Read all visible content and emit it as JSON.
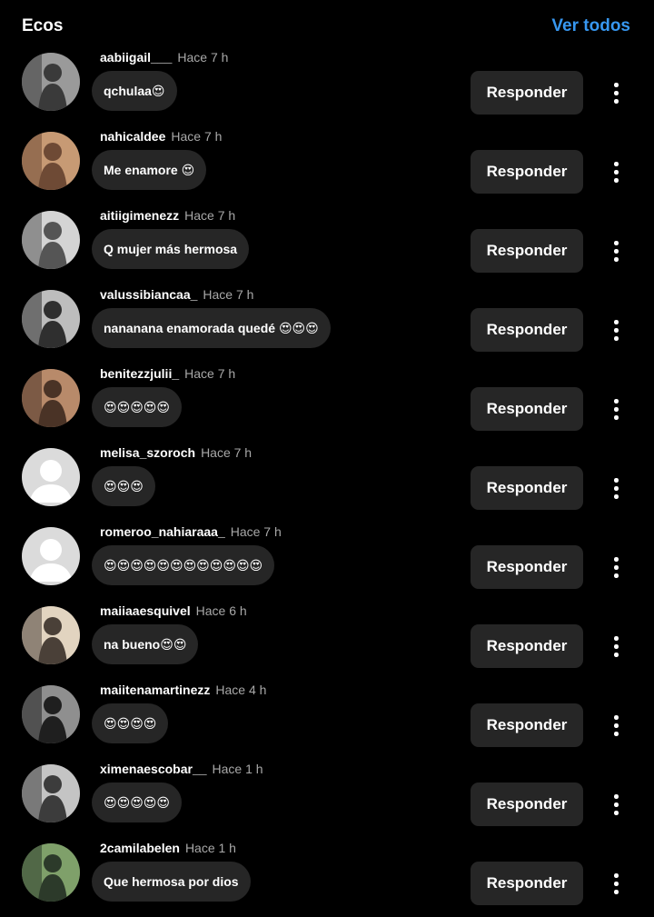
{
  "header": {
    "title": "Ecos",
    "view_all": "Ver todos"
  },
  "reply_label": "Responder",
  "comments": [
    {
      "username": "aabiigail___",
      "time": "Hace 7 h",
      "text": "qchulaa😍",
      "avatar": "photo-bw"
    },
    {
      "username": "nahicaldee",
      "time": "Hace 7 h",
      "text": "Me enamore 😍",
      "avatar": "photo-color"
    },
    {
      "username": "aitiigimenezz",
      "time": "Hace 7 h",
      "text": "Q mujer más hermosa",
      "avatar": "photo-bw"
    },
    {
      "username": "valussibiancaa_",
      "time": "Hace 7 h",
      "text": "nananana enamorada quedé 😍😍😍",
      "avatar": "photo-bw"
    },
    {
      "username": "benitezzjulii_",
      "time": "Hace 7 h",
      "text": "😍😍😍😍😍",
      "avatar": "photo-color"
    },
    {
      "username": "melisa_szoroch",
      "time": "Hace 7 h",
      "text": "😍😍😍",
      "avatar": "default"
    },
    {
      "username": "romeroo_nahiaraaa_",
      "time": "Hace 7 h",
      "text": "😍😍😍😍😍😍😍😍😍😍😍😍",
      "avatar": "default"
    },
    {
      "username": "maiiaaesquivel",
      "time": "Hace 6 h",
      "text": "na bueno😍😍",
      "avatar": "photo-color"
    },
    {
      "username": "maiitenamartinezz",
      "time": "Hace 4 h",
      "text": "😍😍😍😍",
      "avatar": "photo-bw"
    },
    {
      "username": "ximenaescobar__",
      "time": "Hace 1 h",
      "text": "😍😍😍😍😍",
      "avatar": "photo-bw"
    },
    {
      "username": "2camilabelen",
      "time": "Hace 1 h",
      "text": "Que hermosa por dios",
      "avatar": "photo-color"
    }
  ],
  "icons": {
    "more": "more-vertical-icon",
    "default_avatar": "default-avatar-icon"
  },
  "colors": {
    "background": "#000000",
    "bubble": "#262626",
    "button": "#262626",
    "link": "#3797f0",
    "muted": "#a8a8a8"
  }
}
